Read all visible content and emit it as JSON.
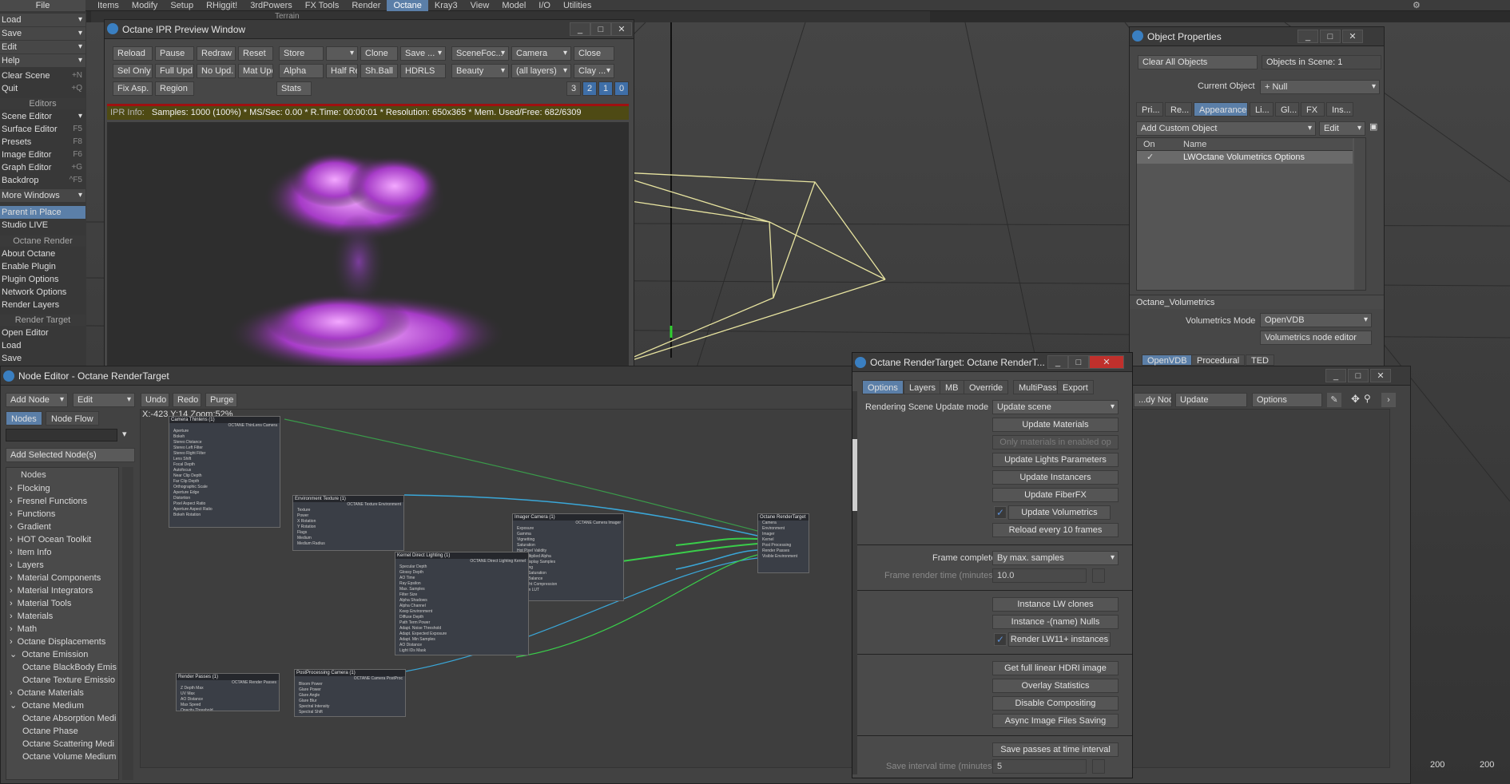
{
  "topbar": {
    "file": "File",
    "menus": [
      "Items",
      "Modify",
      "Setup",
      "RHiggit!",
      "3rdPowers",
      "FX Tools",
      "Render",
      "Octane",
      "Kray3",
      "View",
      "Model",
      "I/O",
      "Utilities"
    ],
    "active_menu": "Octane",
    "vp_frag": "Terrain"
  },
  "left_menu": {
    "file_items": [
      {
        "label": "Load"
      },
      {
        "label": "Save"
      },
      {
        "label": "Edit"
      },
      {
        "label": "Help"
      }
    ],
    "clear_scene": "Clear Scene",
    "clear_sc": "+N",
    "quit": "Quit",
    "quit_sc": "+Q",
    "editors_head": "Editors",
    "editors": [
      {
        "label": "Scene Editor",
        "sc": ""
      },
      {
        "label": "Surface Editor",
        "sc": "F5"
      },
      {
        "label": "Presets",
        "sc": "F8"
      },
      {
        "label": "Image Editor",
        "sc": "F6"
      },
      {
        "label": "Graph Editor",
        "sc": "+G"
      },
      {
        "label": "Backdrop",
        "sc": "^F5"
      }
    ],
    "more_windows": "More Windows",
    "parent_in_place": "Parent in Place",
    "studio_live": "Studio LIVE",
    "octane_head": "Octane Render",
    "octane_items": [
      "About Octane",
      "Enable Plugin",
      "Plugin Options",
      "Network Options",
      "Render Layers"
    ],
    "rt_head": "Render Target",
    "rt_items": [
      "Open Editor",
      "Load",
      "Save"
    ]
  },
  "ipr": {
    "title": "Octane IPR Preview Window",
    "row1": [
      "Reload",
      "Pause",
      "Redraw",
      "Reset",
      "Store",
      "",
      "Clone",
      "Save ...",
      "SceneFoc...",
      "Camera",
      "Close"
    ],
    "row2": [
      "Sel Only",
      "Full Upd.",
      "No Upd.",
      "Mat Upd",
      "Alpha",
      "Half Res",
      "Sh.Ball",
      "HDRLS",
      "Beauty",
      "(all layers)",
      "Clay ..."
    ],
    "row3": [
      "Fix Asp.",
      "Region",
      "Stats"
    ],
    "nums": [
      "3",
      "2",
      "1",
      "0"
    ],
    "info_label": "IPR Info:",
    "info": "Samples: 1000 (100%)  *  MS/Sec: 0.00  *  R.Time: 00:00:01  *  Resolution: 650x365  *  Mem. Used/Free: 682/6309"
  },
  "objprops": {
    "title": "Object Properties",
    "clear_all": "Clear All Objects",
    "objects_in_scene": "Objects in Scene: 1",
    "current_object_label": "Current Object",
    "current_object": "Null",
    "tabs": [
      "Pri...",
      "Re...",
      "Appearance",
      "Li...",
      "Gl...",
      "FX",
      "Ins..."
    ],
    "add_custom": "Add Custom Object",
    "edit": "Edit",
    "col_on": "On",
    "col_name": "Name",
    "row_check": "✓",
    "row_name": "LWOctane Volumetrics Options",
    "section": "Octane_Volumetrics",
    "vol_mode_label": "Volumetrics Mode",
    "vol_mode": "OpenVDB",
    "vol_node_editor": "Volumetrics node editor",
    "subtabs": [
      "OpenVDB",
      "Procedural",
      "TED"
    ]
  },
  "nodeeditor": {
    "title": "Node Editor - Octane RenderTarget",
    "add_node": "Add Node",
    "edit": "Edit",
    "undo": "Undo",
    "redo": "Redo",
    "purge": "Purge",
    "tab_nodes": "Nodes",
    "tab_flow": "Node Flow",
    "add_selected": "Add Selected Node(s)",
    "coords": "X:-423 Y:14 Zoom:52%",
    "tree_head": "Nodes",
    "tree": [
      {
        "a": "›",
        "t": "Flocking"
      },
      {
        "a": "›",
        "t": "Fresnel Functions"
      },
      {
        "a": "›",
        "t": "Functions"
      },
      {
        "a": "›",
        "t": "Gradient"
      },
      {
        "a": "›",
        "t": "HOT Ocean Toolkit"
      },
      {
        "a": "›",
        "t": "Item Info"
      },
      {
        "a": "›",
        "t": "Layers"
      },
      {
        "a": "›",
        "t": "Material Components"
      },
      {
        "a": "›",
        "t": "Material Integrators"
      },
      {
        "a": "›",
        "t": "Material Tools"
      },
      {
        "a": "›",
        "t": "Materials"
      },
      {
        "a": "›",
        "t": "Math"
      },
      {
        "a": "›",
        "t": "Octane Displacements"
      },
      {
        "a": "⌄",
        "t": "Octane Emission"
      },
      {
        "a": "",
        "t": "Octane BlackBody Emis"
      },
      {
        "a": "",
        "t": "Octane Texture Emissio"
      },
      {
        "a": "›",
        "t": "Octane Materials"
      },
      {
        "a": "⌄",
        "t": "Octane Medium"
      },
      {
        "a": "",
        "t": "Octane Absorption Medi"
      },
      {
        "a": "",
        "t": "Octane Phase"
      },
      {
        "a": "",
        "t": "Octane Scattering Medi"
      },
      {
        "a": "",
        "t": "Octane Volume Medium"
      }
    ],
    "right_btns": [
      "...dy Nodes",
      "Update",
      "Options"
    ],
    "nodes": [
      {
        "title": "Camera Thinlens (1)",
        "sub": "OCTANE ThinLens Camera",
        "rows": [
          "Aperture",
          "Bokeh",
          "Stereo Distance",
          "Stereo Left Filter",
          "Stereo Right Filter",
          "Lens Shift",
          "Focal Depth",
          "Autofocus",
          "Near Clip Depth",
          "Far Clip Depth",
          "Orthographic Scale",
          "Aperture Edge",
          "Distortion",
          "Pixel Aspect Ratio",
          "Aperture Aspect Ratio",
          "Bokeh Rotation"
        ]
      },
      {
        "title": "Environment Texture (1)",
        "sub": "OCTANE Texture Environment",
        "rows": [
          "Texture",
          "Power",
          "X Rotation",
          "Y Rotation",
          "Flags",
          "Medium",
          "Medium Radius"
        ]
      },
      {
        "title": "Imager Camera (1)",
        "sub": "OCTANE Camera Imager",
        "rows": [
          "Exposure",
          "Gamma",
          "Vignetting",
          "Saturation",
          "Hot Pixel Validity",
          "Premultiplied Alpha",
          "Min. Display Samples",
          "Dithering",
          "White Saturation",
          "White Balance",
          "Highlight Compression",
          "Custom LUT"
        ]
      },
      {
        "title": "Octane RenderTarget",
        "sub": "",
        "rows": [
          "Camera",
          "Environment",
          "Imager",
          "Kernel",
          "Post Processing",
          "Render Passes",
          "Visible Environment"
        ]
      },
      {
        "title": "Kernel Direct Lighting (1)",
        "sub": "OCTANE Direct Lighting Kernel",
        "rows": [
          "Specular Depth",
          "Glossy Depth",
          "AO Time",
          "Ray Epsilon",
          "Max. Samples",
          "Filter Size",
          "Alpha Shadows",
          "Alpha Channel",
          "Keep Environment",
          "Diffuse Depth",
          "Path Term Power",
          "Adapt. Noise Threshold",
          "Adapt. Expected Exposure",
          "Adapt. Min Samples",
          "AO Distance",
          "Light IDs Mask"
        ]
      },
      {
        "title": "Render Passes (1)",
        "sub": "OCTANE Render Passes",
        "rows": [
          "Z Depth Max",
          "UV Max",
          "AO Distance",
          "Max Speed",
          "Opacity Threshold"
        ]
      },
      {
        "title": "PostProcessing Camera (1)",
        "sub": "OCTANE Camera PostProc",
        "rows": [
          "Bloom Power",
          "Glare Power",
          "Glare Angle",
          "Glare Blur",
          "Spectral Intensity",
          "Spectral Shift"
        ]
      }
    ]
  },
  "rtwin": {
    "title": "Octane RenderTarget: Octane RenderT...",
    "tabs": [
      "Options",
      "Layers",
      "MB",
      "Override",
      "MultiPass",
      "Export"
    ],
    "scene_update_label": "Rendering Scene Update mode",
    "scene_update": "Update scene",
    "btn_update_materials": "Update Materials",
    "btn_only_mats": "Only materials in enabled op",
    "btn_lights": "Update Lights Parameters",
    "btn_instancers": "Update Instancers",
    "btn_fiberfx": "Update FiberFX",
    "chk_volumetrics": "Update Volumetrics",
    "btn_reload": "Reload every 10 frames",
    "frame_complete_label": "Frame complete",
    "frame_complete": "By max. samples",
    "frame_time_label": "Frame render time (minutes)",
    "frame_time": "10.0",
    "btn_lw_clones": "Instance LW clones",
    "btn_name_nulls": "Instance -(name) Nulls",
    "chk_lw11": "Render LW11+ instances",
    "btn_hdri": "Get full linear HDRI image",
    "btn_overlay": "Overlay Statistics",
    "btn_disable_comp": "Disable Compositing",
    "btn_async": "Async Image Files Saving",
    "btn_save_passes": "Save passes at time interval",
    "save_interval_label": "Save interval time (minutes)",
    "save_interval": "5"
  },
  "bottom_right": {
    "a": "200",
    "b": "200"
  }
}
